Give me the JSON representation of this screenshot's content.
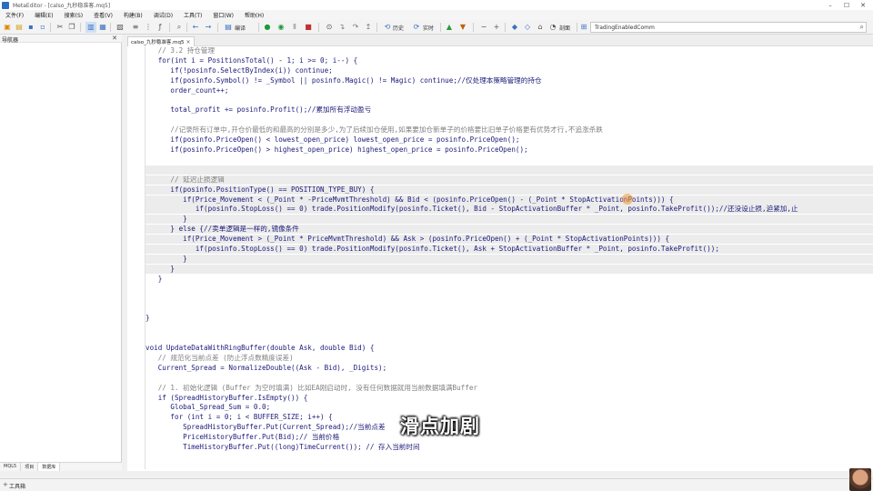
{
  "window": {
    "title": "MetaEditor - [calso_九秒稳准客.mq5]"
  },
  "menu": [
    {
      "label": "文件(F)"
    },
    {
      "label": "编辑(E)"
    },
    {
      "label": "搜索(S)"
    },
    {
      "label": "查看(V)"
    },
    {
      "label": "构建(B)"
    },
    {
      "label": "调试(D)"
    },
    {
      "label": "工具(T)"
    },
    {
      "label": "窗口(W)"
    },
    {
      "label": "帮助(H)"
    }
  ],
  "toolbar": {
    "compile_label": "编译",
    "history_label": "历史",
    "realtime_label": "实时",
    "profile_label": "剖面",
    "search_value": "TradingEnabledComm"
  },
  "navigator": {
    "title": "导航器",
    "tabs": [
      "MQL5",
      "项目",
      "数据库"
    ]
  },
  "editor": {
    "file_tab": "calso_九秒稳准客.mq5"
  },
  "code_lines": [
    {
      "n": "284",
      "text": "   // 3.2 持仓管理",
      "cls": "c-cm"
    },
    {
      "n": "285",
      "text": "   for(int i = PositionsTotal() - 1; i >= 0; i--) {"
    },
    {
      "n": "286",
      "text": "      if(!posinfo.SelectByIndex(i)) continue;"
    },
    {
      "n": "287",
      "text": "      if(posinfo.Symbol() != _Symbol || posinfo.Magic() != Magic) continue;//仅处理本策略管理的持仓"
    },
    {
      "n": "288",
      "text": "      order_count++;"
    },
    {
      "n": "289",
      "text": ""
    },
    {
      "n": "290",
      "text": "      total_profit += posinfo.Profit();//累加所有浮动盈亏"
    },
    {
      "n": "291",
      "text": ""
    },
    {
      "n": "292",
      "text": "      //记录所有订单中,开仓价最低的和最高的分别是多少,为了后续加仓使用,如果要加仓新单子的价格要比旧单子价格更有优势才行,不追涨杀跌",
      "cls": "c-cm"
    },
    {
      "n": "293",
      "text": "      if(posinfo.PriceOpen() < lowest_open_price) lowest_open_price = posinfo.PriceOpen();"
    },
    {
      "n": "294",
      "text": "      if(posinfo.PriceOpen() > highest_open_price) highest_open_price = posinfo.PriceOpen();"
    },
    {
      "n": "295",
      "text": ""
    },
    {
      "n": "296",
      "text": "",
      "hl": true
    },
    {
      "n": "297",
      "text": "      // 延迟止损逻辑",
      "cls": "c-cm",
      "hl": true
    },
    {
      "n": "298",
      "text": "      if(posinfo.PositionType() == POSITION_TYPE_BUY) {",
      "hl": true
    },
    {
      "n": "299",
      "text": "         if(Price_Movement < (_Point * -PriceMvmtThreshold) && Bid < (posinfo.PriceOpen() - (_Point * StopActivationPoints))) {",
      "hl": true
    },
    {
      "n": "300",
      "text": "            if(posinfo.StopLoss() == 0) trade.PositionModify(posinfo.Ticket(), Bid - StopActivationBuffer * _Point, posinfo.TakeProfit());//还没设止损,迫紧加,止",
      "hl": true
    },
    {
      "n": "301",
      "text": "         }",
      "hl": true
    },
    {
      "n": "302",
      "text": "      } else {//卖单逻辑是一样的,镜像条件",
      "hl": true
    },
    {
      "n": "303",
      "text": "         if(Price_Movement > (_Point * PriceMvmtThreshold) && Ask > (posinfo.PriceOpen() + (_Point * StopActivationPoints))) {",
      "hl": true
    },
    {
      "n": "304",
      "text": "            if(posinfo.StopLoss() == 0) trade.PositionModify(posinfo.Ticket(), Ask + StopActivationBuffer * _Point, posinfo.TakeProfit());",
      "hl": true
    },
    {
      "n": "305",
      "text": "         }",
      "hl": true
    },
    {
      "n": "306",
      "text": "      }",
      "hl": true
    },
    {
      "n": "307",
      "text": "   }"
    },
    {
      "n": "308",
      "text": ""
    },
    {
      "n": "309",
      "text": ""
    },
    {
      "n": "310",
      "text": ""
    },
    {
      "n": "311",
      "text": "}"
    },
    {
      "n": "312",
      "text": ""
    },
    {
      "n": "313",
      "text": ""
    },
    {
      "n": "314",
      "text": "void UpdateDataWithRingBuffer(double Ask, double Bid) {"
    },
    {
      "n": "315",
      "text": "   // 规范化当前点差 (防止浮点数精度误差)",
      "cls": "c-cm"
    },
    {
      "n": "316",
      "text": "   Current_Spread = NormalizeDouble((Ask - Bid), _Digits);"
    },
    {
      "n": "317",
      "text": ""
    },
    {
      "n": "318",
      "text": "   // 1. 初始化逻辑 (Buffer 为空时填满) 比如EA刚启动时, 没有任何数据就用当前数据填满Buffer",
      "cls": "c-cm"
    },
    {
      "n": "319",
      "text": "   if (SpreadHistoryBuffer.IsEmpty()) {"
    },
    {
      "n": "320",
      "text": "      Global_Spread_Sum = 0.0;"
    },
    {
      "n": "321",
      "text": "      for (int i = 0; i < BUFFER_SIZE; i++) {"
    },
    {
      "n": "322",
      "text": "         SpreadHistoryBuffer.Put(Current_Spread);//当前点差"
    },
    {
      "n": "323",
      "text": "         PriceHistoryBuffer.Put(Bid);// 当前价格"
    },
    {
      "n": "324",
      "text": "         TimeHistoryBuffer.Put((long)TimeCurrent()); // 存入当前时间"
    },
    {
      "n": "325",
      "text": ""
    }
  ],
  "subtitle": "滑点加剧",
  "statusbar": {
    "label": "工具箱"
  },
  "colors": {
    "accent": "#2a6fbf",
    "keyword": "#1a1a9a",
    "comment": "#808080",
    "macro": "#b0006a"
  }
}
